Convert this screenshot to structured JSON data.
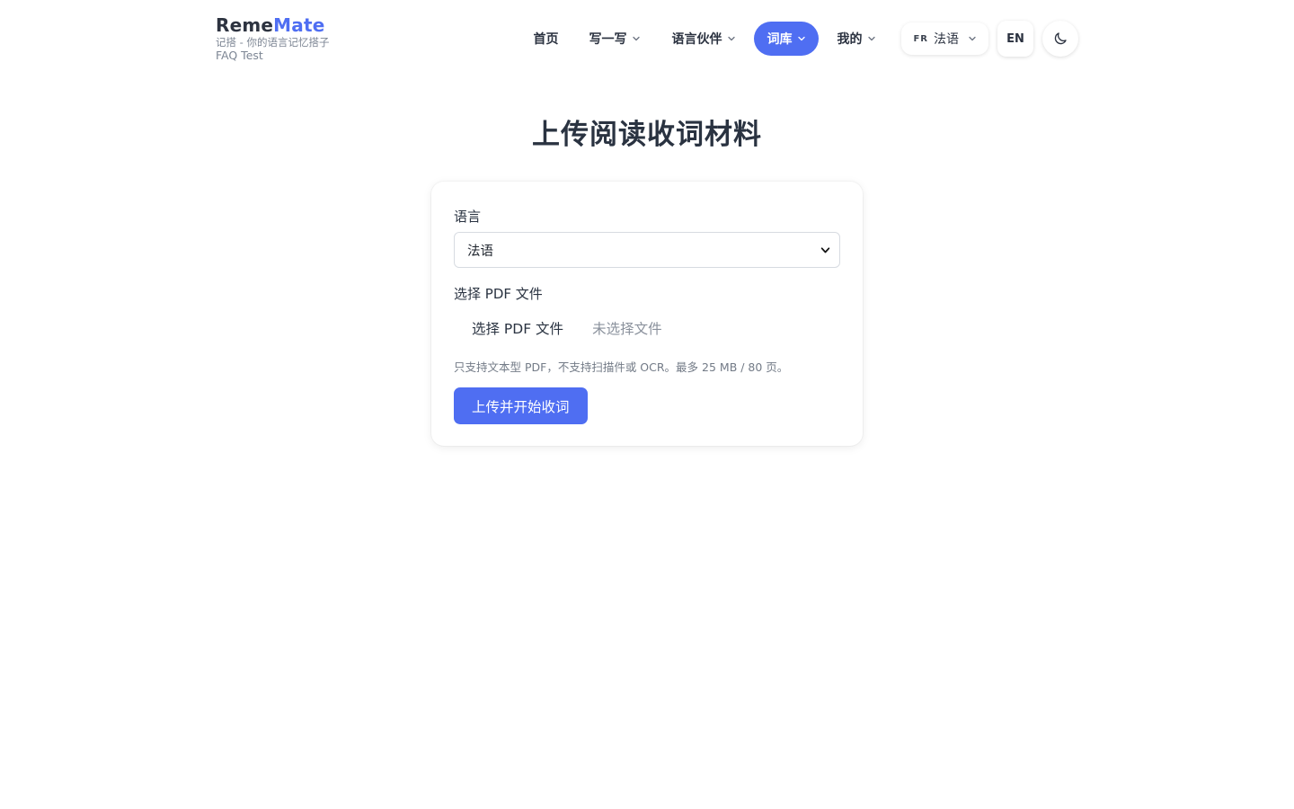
{
  "brand": {
    "name_part1": "Reme",
    "name_part2": "Mate",
    "tagline": "记搭 - 你的语言记忆搭子",
    "subline": "FAQ Test"
  },
  "nav": {
    "items": [
      {
        "label": "首页",
        "has_dropdown": false,
        "active": false
      },
      {
        "label": "写一写",
        "has_dropdown": true,
        "active": false
      },
      {
        "label": "语言伙伴",
        "has_dropdown": true,
        "active": false
      },
      {
        "label": "词库",
        "has_dropdown": true,
        "active": true
      },
      {
        "label": "我的",
        "has_dropdown": true,
        "active": false
      }
    ],
    "study_language": {
      "code": "FR",
      "label": "法语"
    },
    "ui_language": "EN",
    "theme_icon": "moon-icon"
  },
  "page": {
    "title": "上传阅读收词材料"
  },
  "form": {
    "language_label": "语言",
    "language_selected": "法语",
    "pdf_label": "选择 PDF 文件",
    "file_button": "选择 PDF 文件",
    "file_status": "未选择文件",
    "hint": "只支持文本型 PDF，不支持扫描件或 OCR。最多 25 MB / 80 页。",
    "submit_label": "上传并开始收词"
  },
  "colors": {
    "accent": "#4f6ef2",
    "text": "#2a3341",
    "muted": "#7d8694"
  }
}
